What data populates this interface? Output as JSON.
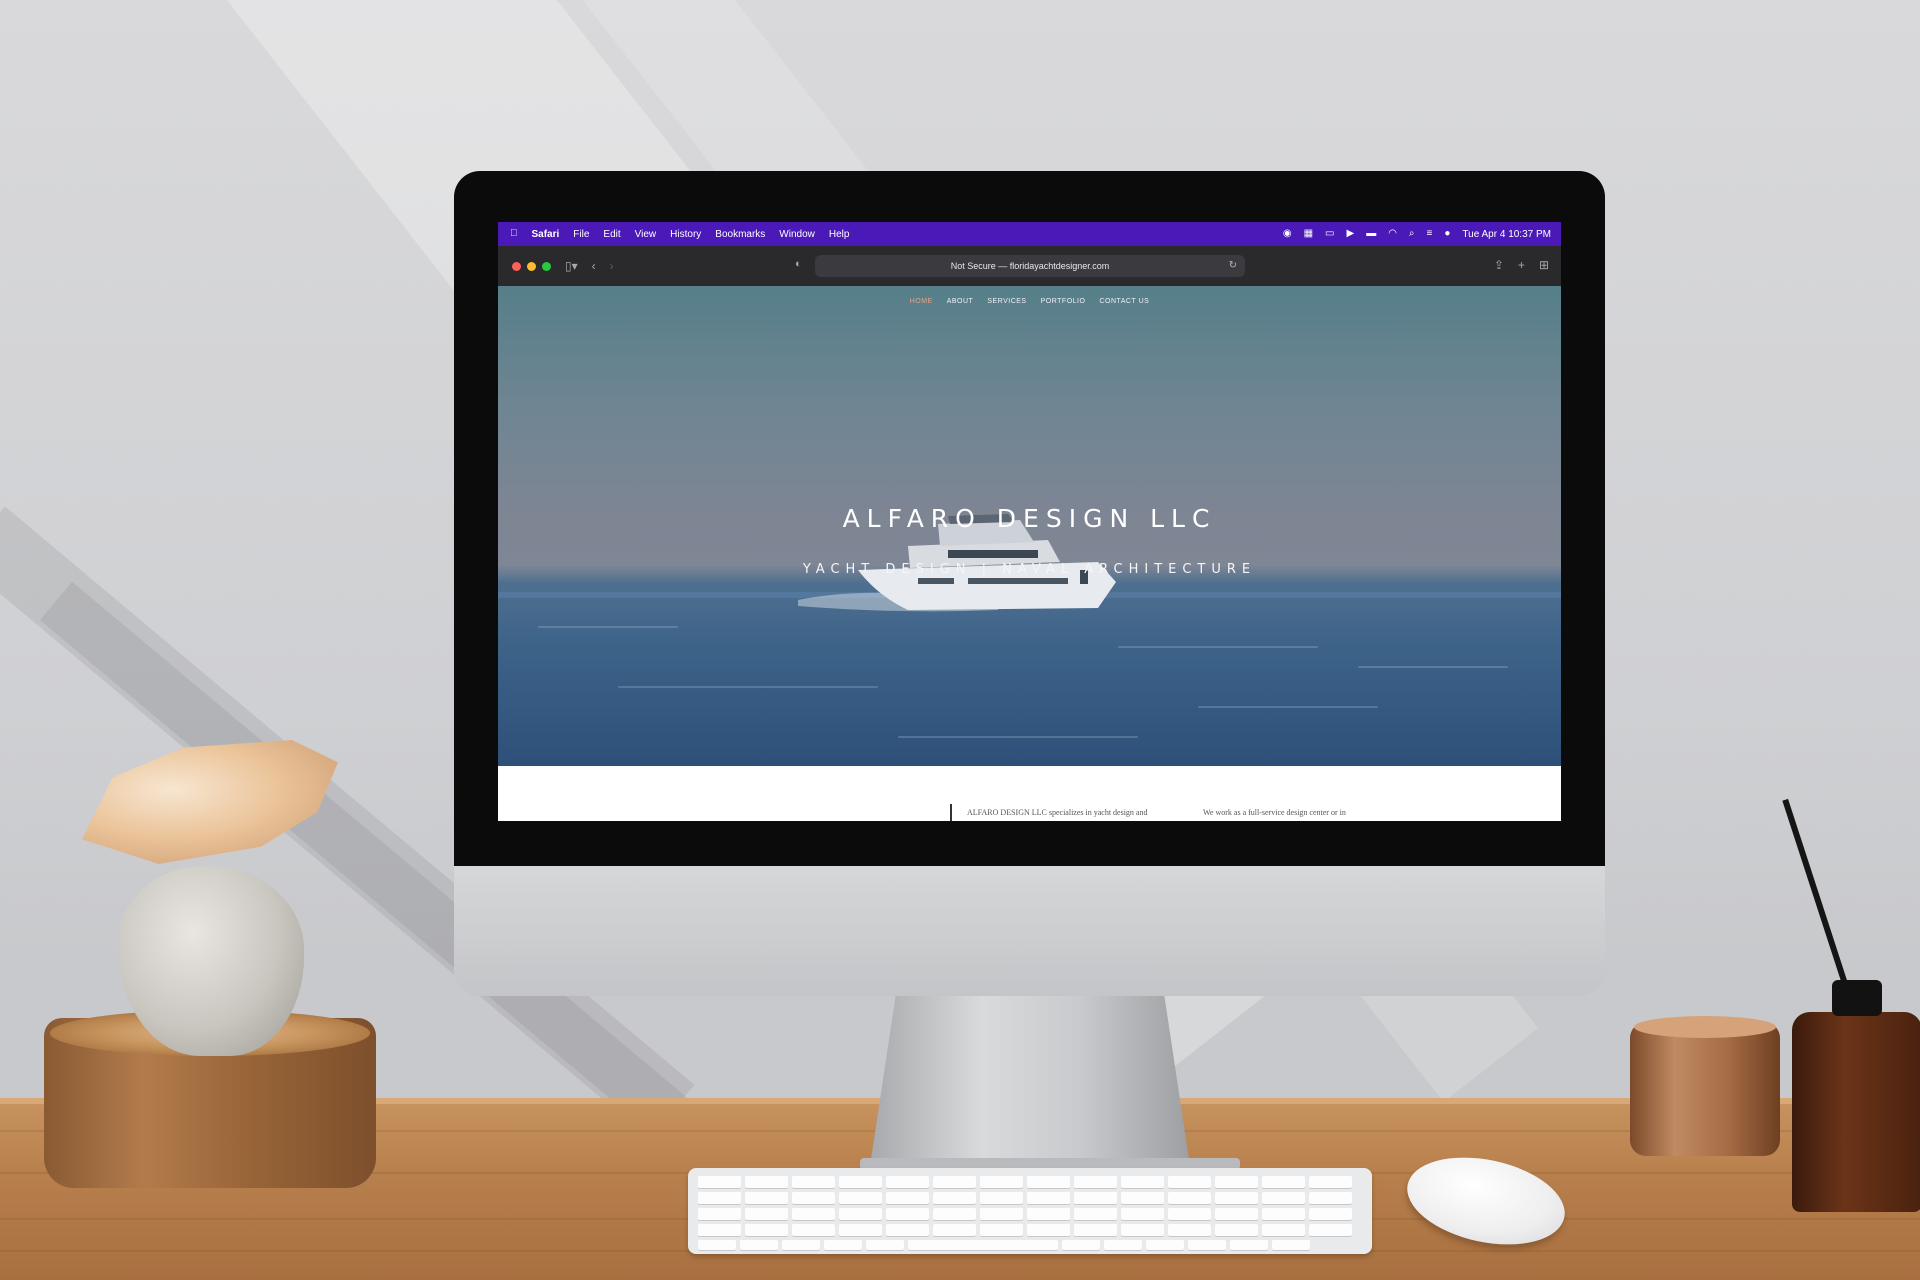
{
  "menubar": {
    "app_name": "Safari",
    "items": [
      "File",
      "Edit",
      "View",
      "History",
      "Bookmarks",
      "Window",
      "Help"
    ],
    "datetime": "Tue Apr 4  10:37 PM"
  },
  "browser": {
    "url_text": "Not Secure — floridayachtdesigner.com"
  },
  "site": {
    "nav": [
      "HOME",
      "ABOUT",
      "SERVICES",
      "PORTFOLIO",
      "CONTACT US"
    ],
    "title": "ALFARO DESIGN LLC",
    "subtitle": "YACHT DESIGN | NAVAL ARCHITECTURE",
    "intro_left": "ALFARO DESIGN LLC specializes in yacht design and",
    "intro_right": "We work as a full-service design center or in"
  },
  "colors": {
    "menubar": "#4b19b8",
    "nav_active": "#e2a58a",
    "close": "#ff5f57",
    "minimize": "#febc2e",
    "zoom": "#28c840"
  },
  "icons": {
    "apple": "apple-icon",
    "sidebar": "sidebar-icon",
    "back": "chevron-left-icon",
    "forward": "chevron-right-icon",
    "privacy": "shield-icon",
    "reload": "reload-icon",
    "share": "share-icon",
    "new_tab": "plus-icon",
    "tab_overview": "grid-icon"
  }
}
